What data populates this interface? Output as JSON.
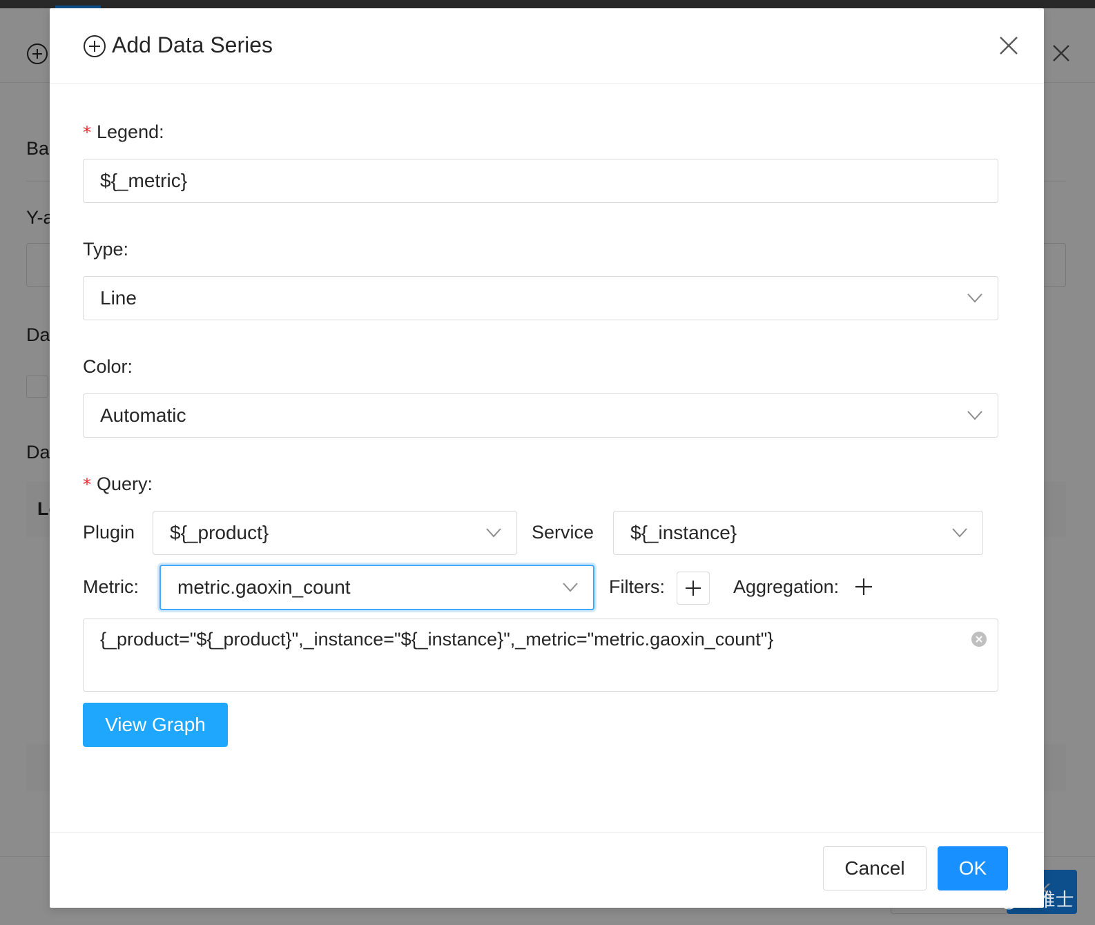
{
  "background": {
    "labels": [
      "Ba",
      "Y-a",
      "Da",
      "Da"
    ],
    "table_header": "Le",
    "footer_button": "K"
  },
  "modal": {
    "title": "Add Data Series",
    "legend": {
      "label": "Legend:",
      "required_mark": "*",
      "value": "${_metric}"
    },
    "type": {
      "label": "Type:",
      "value": "Line"
    },
    "color": {
      "label": "Color:",
      "value": "Automatic"
    },
    "query": {
      "label": "Query:",
      "required_mark": "*",
      "plugin_label": "Plugin",
      "plugin_value": "${_product}",
      "service_label": "Service",
      "service_value": "${_instance}",
      "metric_label": "Metric:",
      "metric_value": "metric.gaoxin_count",
      "filters_label": "Filters:",
      "aggregation_label": "Aggregation:",
      "expression": "{_product=\"${_product}\",_instance=\"${_instance}\",_metric=\"metric.gaoxin_count\"}"
    },
    "view_graph_label": "View Graph",
    "cancel_label": "Cancel",
    "ok_label": "OK"
  },
  "watermark": "CSDN @择维士",
  "colors": {
    "primary": "#1890ff",
    "view_graph": "#1ea7fd",
    "required": "#f5222d",
    "focus": "#40a9ff"
  },
  "icons": [
    "plus-circle-icon",
    "close-icon",
    "chevron-down-icon",
    "plus-icon",
    "clear-circle-icon"
  ]
}
